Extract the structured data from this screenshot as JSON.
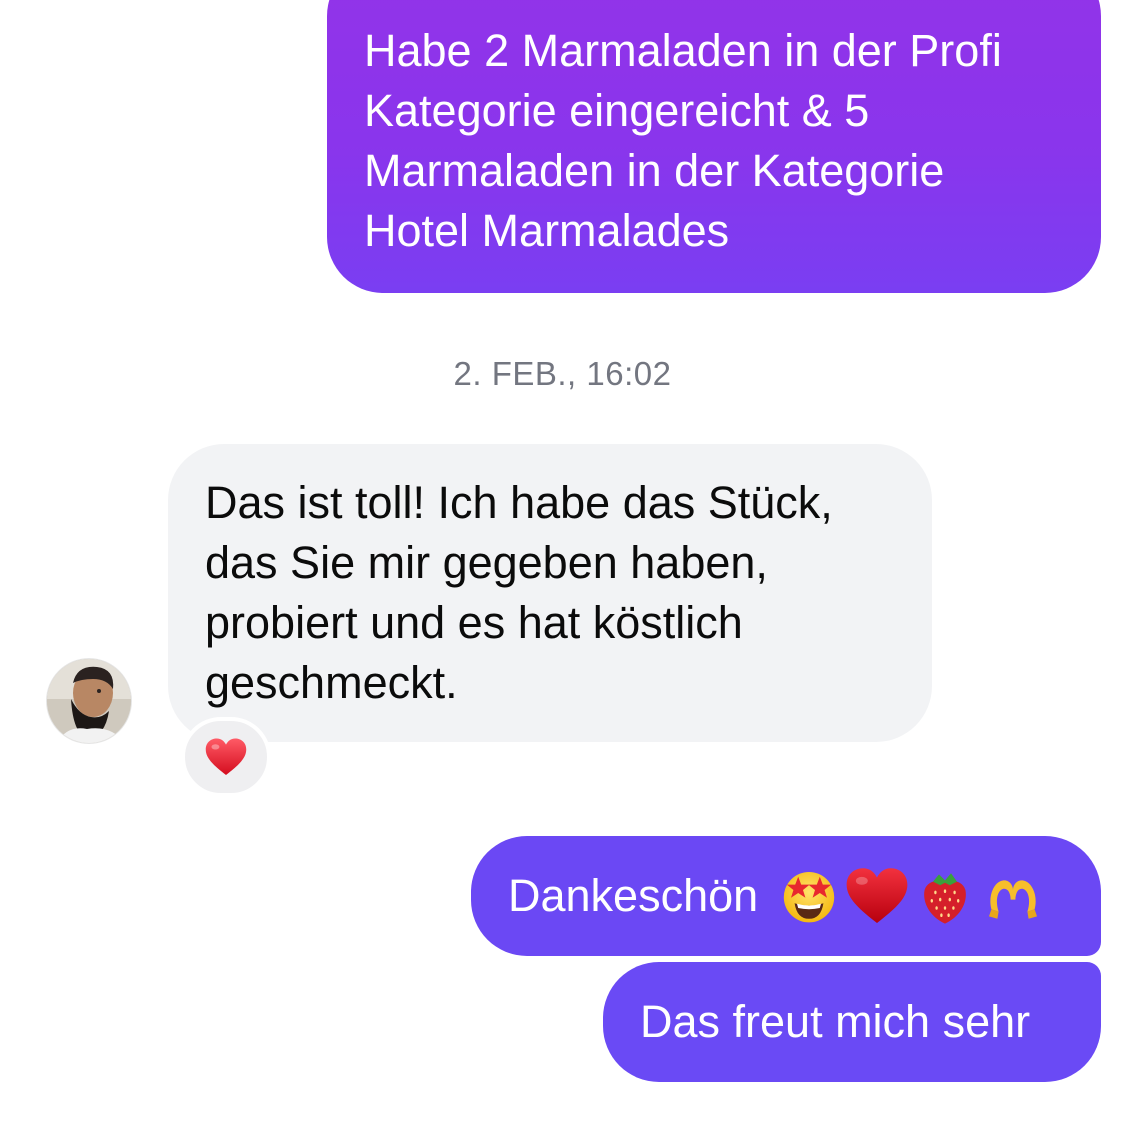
{
  "conversation": {
    "messages": [
      {
        "id": "m1",
        "direction": "outgoing",
        "text": "Habe 2 Marmaladen in der Profi\nKategorie eingereicht & 5\nMarmaladen in der Kategorie\nHotel Marmalades"
      },
      {
        "id": "m2",
        "direction": "incoming",
        "text": "Das ist toll! Ich habe das Stück,\ndas Sie mir gegeben haben,\nprobiert und es hat köstlich\ngeschmeckt.",
        "reaction_icon": "red-heart-emoji"
      },
      {
        "id": "m3",
        "direction": "outgoing",
        "text": "Dankeschön",
        "emojis": [
          "star-struck-emoji",
          "red-heart-emoji",
          "strawberry-emoji",
          "heart-hands-emoji"
        ]
      },
      {
        "id": "m4",
        "direction": "outgoing",
        "text": "Das freut mich sehr"
      }
    ],
    "timestamp": "2. FEB., 16:02"
  },
  "colors": {
    "outgoing_gradient_top": "#9333e8",
    "outgoing_gradient_bottom": "#7a3ef2",
    "outgoing_solid": "#6b48f4",
    "incoming_background": "#f2f3f5",
    "timestamp_text": "#737680"
  },
  "sender_avatar": {
    "icon": "contact-avatar"
  }
}
